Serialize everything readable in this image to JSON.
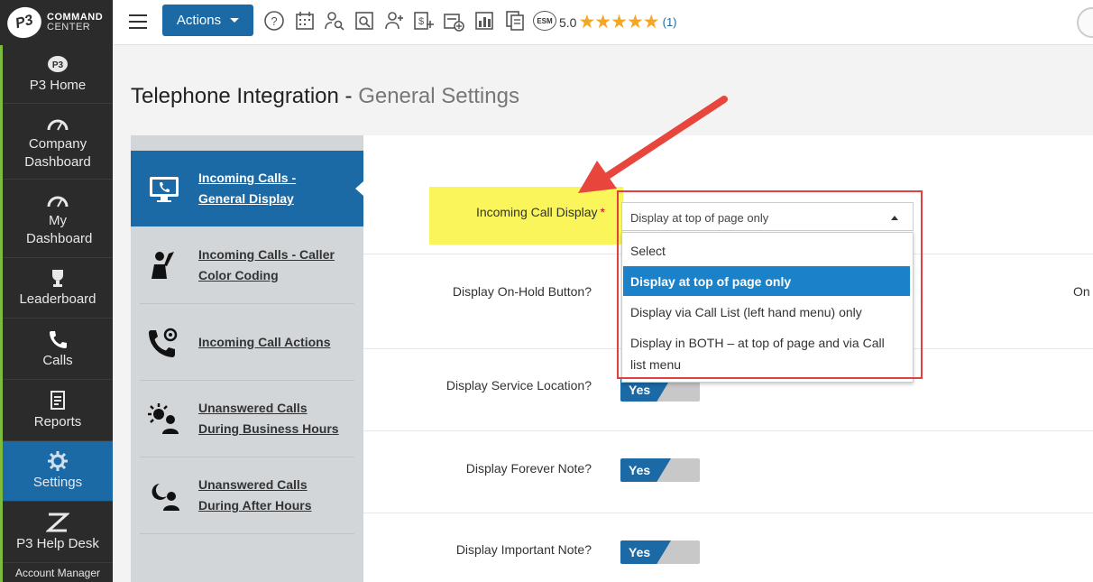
{
  "app": {
    "logo_top": "COMMAND",
    "logo_bottom": "CENTER",
    "logo_mark": "P3"
  },
  "leftnav": {
    "items": [
      {
        "label": "P3 Home"
      },
      {
        "label": "Company Dashboard"
      },
      {
        "label": "My Dashboard"
      },
      {
        "label": "Leaderboard"
      },
      {
        "label": "Calls"
      },
      {
        "label": "Reports"
      },
      {
        "label": "Settings"
      },
      {
        "label": "P3 Help Desk"
      },
      {
        "label": "Account Manager"
      }
    ],
    "active": "Settings",
    "accent_color": "#7dbb3a",
    "active_color": "#1b6aa5"
  },
  "topbar": {
    "actions_label": "Actions",
    "icons": [
      "help-icon",
      "calendar-icon",
      "user-search-icon",
      "search-list-icon",
      "add-user-icon",
      "add-invoice-icon",
      "add-event-icon",
      "bar-chart-icon",
      "documents-icon",
      "esm-badge-icon"
    ],
    "esm_label": "ESM",
    "rating_value": "5.0",
    "rating_stars": "★★★★★",
    "rating_count": "(1)"
  },
  "page": {
    "title_main": "Telephone Integration - ",
    "title_sub": "General Settings"
  },
  "submenu": {
    "items": [
      {
        "line1": "Incoming Calls -",
        "line2": "General Display",
        "icon": "monitor-phone-icon"
      },
      {
        "line1": "Incoming Calls - Caller",
        "line2": "Color Coding",
        "icon": "paint-brush-person-icon"
      },
      {
        "line1": "Incoming Call Actions",
        "line2": "",
        "icon": "phone-gear-icon"
      },
      {
        "line1": "Unanswered Calls",
        "line2": "During Business Hours",
        "icon": "sun-person-icon"
      },
      {
        "line1": "Unanswered Calls",
        "line2": "During After Hours",
        "icon": "moon-person-icon"
      }
    ]
  },
  "form": {
    "incoming_call_display_label": "Incoming Call Display",
    "required_mark": "*",
    "incoming_call_display_value": "Display at top of page only",
    "dropdown_options": [
      "Select",
      "Display at top of page only",
      "Display via Call List (left hand menu) only",
      "Display in BOTH – at top of page and via Call list menu"
    ],
    "dropdown_selected_index": 1,
    "on_hold_label": "Display On-Hold Button?",
    "on_hold_right_text": "On",
    "service_location_label": "Display Service Location?",
    "forever_note_label": "Display Forever Note?",
    "important_note_label": "Display Important Note?",
    "toggle_yes": "Yes"
  },
  "colors": {
    "highlight": "#f9f55a",
    "annotation_red": "#e04040",
    "brand_blue": "#1b6aa5",
    "star": "#f5a623"
  }
}
